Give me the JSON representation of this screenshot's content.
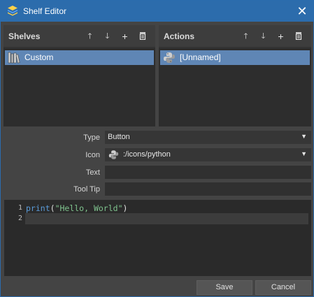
{
  "window": {
    "title": "Shelf Editor"
  },
  "shelves": {
    "heading": "Shelves",
    "items": [
      {
        "label": "Custom"
      }
    ]
  },
  "actions": {
    "heading": "Actions",
    "items": [
      {
        "label": "[Unnamed]"
      }
    ]
  },
  "form": {
    "type_label": "Type",
    "type_value": "Button",
    "icon_label": "Icon",
    "icon_value": ":/icons/python",
    "text_label": "Text",
    "text_value": "",
    "tooltip_label": "Tool Tip",
    "tooltip_value": ""
  },
  "editor": {
    "line_numbers": [
      "1",
      "2"
    ],
    "line1": {
      "keyword": "print",
      "open": "(",
      "string": "\"Hello, World\"",
      "close": ")"
    }
  },
  "buttons": {
    "save": "Save",
    "cancel": "Cancel"
  },
  "icons": {
    "up": "arrow-up-icon",
    "down": "arrow-down-icon",
    "add": "plus-icon",
    "delete": "trash-icon"
  }
}
